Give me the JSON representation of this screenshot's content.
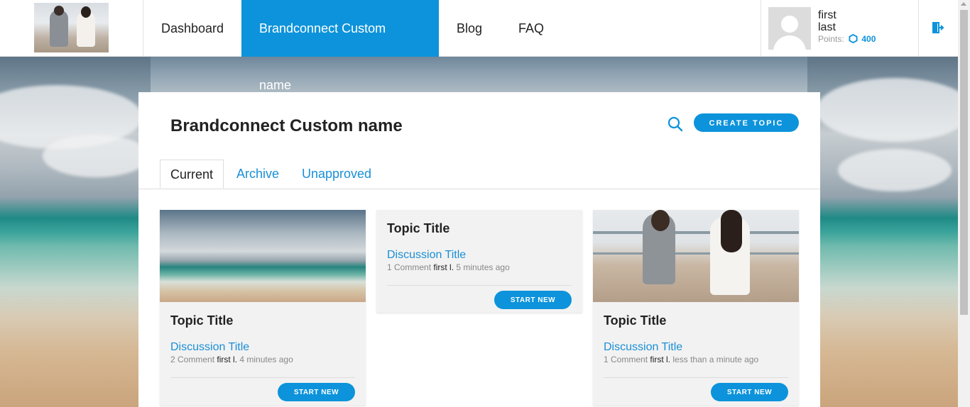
{
  "nav": {
    "items": [
      {
        "label": "Dashboard"
      },
      {
        "label": "Brandconnect Custom name"
      },
      {
        "label": "Blog"
      },
      {
        "label": "FAQ"
      }
    ]
  },
  "user": {
    "first": "first",
    "last": "last",
    "points_label": "Points:",
    "points_value": "400"
  },
  "page": {
    "title": "Brandconnect Custom name",
    "create_label": "CREATE TOPIC"
  },
  "tabs": [
    {
      "label": "Current"
    },
    {
      "label": "Archive"
    },
    {
      "label": "Unapproved"
    }
  ],
  "cards": [
    {
      "topic": "Topic Title",
      "discussion": "Discussion Title",
      "comments": "2 Comment",
      "author": "first l.",
      "time": "4 minutes ago",
      "button": "START NEW",
      "image": "beach-photo"
    },
    {
      "topic": "Topic Title",
      "discussion": "Discussion Title",
      "comments": "1 Comment",
      "author": "first l.",
      "time": "5 minutes ago",
      "button": "START NEW",
      "image": ""
    },
    {
      "topic": "Topic Title",
      "discussion": "Discussion Title",
      "comments": "1 Comment",
      "author": "first l.",
      "time": "less than a minute ago",
      "button": "START NEW",
      "image": "friends-photo"
    }
  ],
  "colors": {
    "accent": "#0c93db",
    "link": "#1a8fd6",
    "card_bg": "#f2f2f2"
  },
  "icons": {
    "search": "search-icon",
    "logout": "logout-icon",
    "points": "hexagon-icon"
  }
}
